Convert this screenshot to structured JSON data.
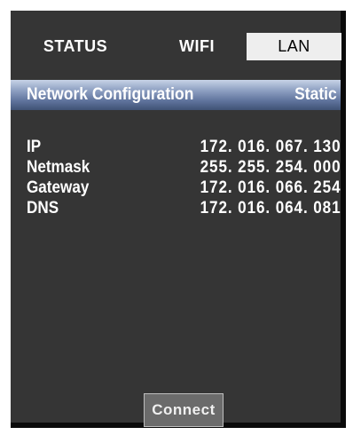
{
  "tabs": [
    {
      "label": "STATUS",
      "active": false
    },
    {
      "label": "WIFI",
      "active": false
    },
    {
      "label": "LAN",
      "active": true
    }
  ],
  "header": {
    "title": "Network Configuration",
    "mode": "Static"
  },
  "config": [
    {
      "label": "IP",
      "value": "172. 016. 067. 130"
    },
    {
      "label": "Netmask",
      "value": "255. 255. 254. 000"
    },
    {
      "label": "Gateway",
      "value": "172. 016. 066. 254"
    },
    {
      "label": "DNS",
      "value": "172. 016. 064. 081"
    }
  ],
  "actions": {
    "connect_label": "Connect"
  },
  "colors": {
    "background": "#353535",
    "active_tab": "#eeeeee",
    "header_bar": "#5f739c",
    "text": "#ffffff"
  }
}
